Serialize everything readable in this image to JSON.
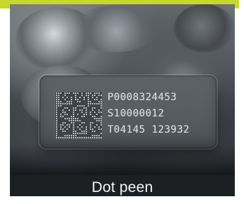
{
  "caption": {
    "text": "Dot peen"
  },
  "plate": {
    "lines": [
      "P0008324453",
      "S10000012",
      "T04145 123932"
    ]
  },
  "colors": {
    "accent_bar": "#c6d82e",
    "caption_bg": "#1d2023",
    "caption_text": "#f3f3f3",
    "engraving": "#d9dde0"
  },
  "icons": {
    "code_name": "data-matrix-code"
  }
}
